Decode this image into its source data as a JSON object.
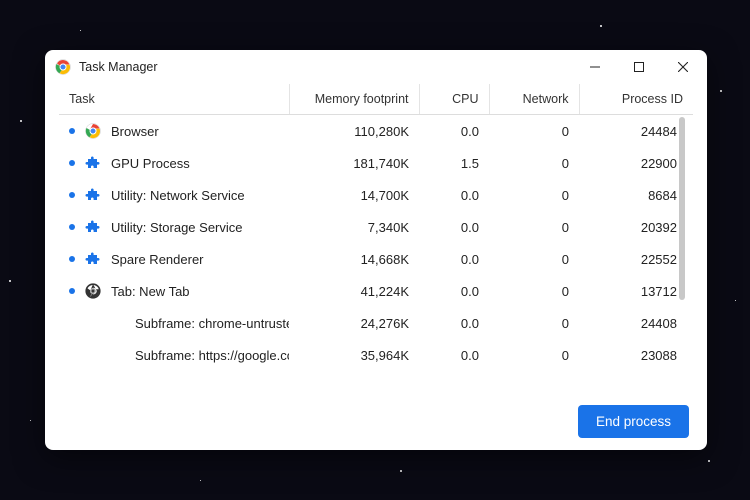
{
  "window": {
    "title": "Task Manager"
  },
  "columns": {
    "task": "Task",
    "memory": "Memory footprint",
    "cpu": "CPU",
    "network": "Network",
    "pid": "Process ID"
  },
  "rows": [
    {
      "bullet": true,
      "icon": "chrome",
      "indent": 0,
      "name": "Browser",
      "memory": "110,280K",
      "cpu": "0.0",
      "network": "0",
      "pid": "24484"
    },
    {
      "bullet": true,
      "icon": "ext",
      "indent": 0,
      "name": "GPU Process",
      "memory": "181,740K",
      "cpu": "1.5",
      "network": "0",
      "pid": "22900"
    },
    {
      "bullet": true,
      "icon": "ext",
      "indent": 0,
      "name": "Utility: Network Service",
      "memory": "14,700K",
      "cpu": "0.0",
      "network": "0",
      "pid": "8684"
    },
    {
      "bullet": true,
      "icon": "ext",
      "indent": 0,
      "name": "Utility: Storage Service",
      "memory": "7,340K",
      "cpu": "0.0",
      "network": "0",
      "pid": "20392"
    },
    {
      "bullet": true,
      "icon": "ext",
      "indent": 0,
      "name": "Spare Renderer",
      "memory": "14,668K",
      "cpu": "0.0",
      "network": "0",
      "pid": "22552"
    },
    {
      "bullet": true,
      "icon": "tab",
      "indent": 0,
      "name": "Tab: New Tab",
      "memory": "41,224K",
      "cpu": "0.0",
      "network": "0",
      "pid": "13712"
    },
    {
      "bullet": false,
      "icon": "none",
      "indent": 1,
      "name": "Subframe: chrome-untrusted:/...",
      "memory": "24,276K",
      "cpu": "0.0",
      "network": "0",
      "pid": "24408"
    },
    {
      "bullet": false,
      "icon": "none",
      "indent": 1,
      "name": "Subframe: https://google.com/",
      "memory": "35,964K",
      "cpu": "0.0",
      "network": "0",
      "pid": "23088"
    }
  ],
  "footer": {
    "end_process": "End process"
  },
  "colors": {
    "accent": "#1a73e8"
  }
}
